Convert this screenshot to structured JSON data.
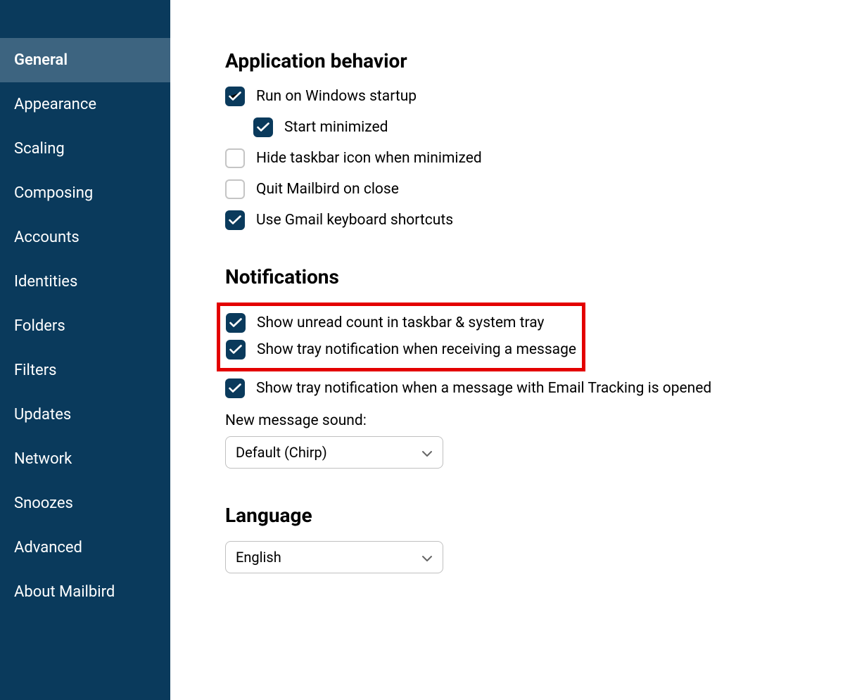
{
  "sidebar": {
    "items": [
      {
        "label": "General",
        "active": true
      },
      {
        "label": "Appearance",
        "active": false
      },
      {
        "label": "Scaling",
        "active": false
      },
      {
        "label": "Composing",
        "active": false
      },
      {
        "label": "Accounts",
        "active": false
      },
      {
        "label": "Identities",
        "active": false
      },
      {
        "label": "Folders",
        "active": false
      },
      {
        "label": "Filters",
        "active": false
      },
      {
        "label": "Updates",
        "active": false
      },
      {
        "label": "Network",
        "active": false
      },
      {
        "label": "Snoozes",
        "active": false
      },
      {
        "label": "Advanced",
        "active": false
      },
      {
        "label": "About Mailbird",
        "active": false
      }
    ]
  },
  "sections": {
    "app_behavior": {
      "title": "Application behavior",
      "items": [
        {
          "label": "Run on Windows startup",
          "checked": true,
          "indented": false
        },
        {
          "label": "Start minimized",
          "checked": true,
          "indented": true
        },
        {
          "label": "Hide taskbar icon when minimized",
          "checked": false,
          "indented": false
        },
        {
          "label": "Quit Mailbird on close",
          "checked": false,
          "indented": false
        },
        {
          "label": "Use Gmail keyboard shortcuts",
          "checked": true,
          "indented": false
        }
      ]
    },
    "notifications": {
      "title": "Notifications",
      "highlighted": [
        {
          "label": "Show unread count in taskbar & system tray",
          "checked": true
        },
        {
          "label": "Show tray notification when receiving a message",
          "checked": true
        }
      ],
      "items": [
        {
          "label": "Show tray notification when a message with Email Tracking is opened",
          "checked": true
        }
      ],
      "sound_label": "New message sound:",
      "sound_value": "Default (Chirp)"
    },
    "language": {
      "title": "Language",
      "value": "English"
    }
  }
}
